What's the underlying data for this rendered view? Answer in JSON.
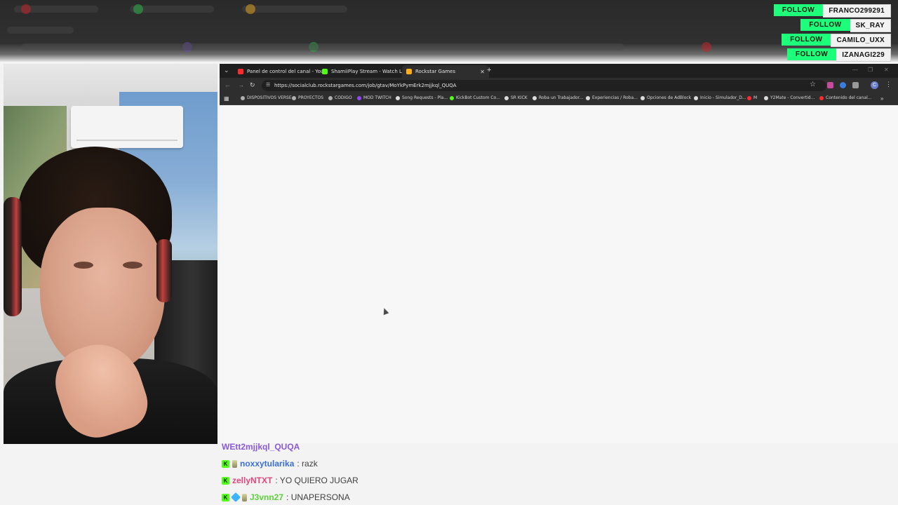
{
  "follows": [
    {
      "button": "FOLLOW",
      "name": "FRANCO299291"
    },
    {
      "button": "FOLLOW",
      "name": "SK_RAY"
    },
    {
      "button": "FOLLOW",
      "name": "CAMILO_UXX"
    },
    {
      "button": "FOLLOW",
      "name": "IZANAGI229"
    }
  ],
  "browser": {
    "tabs": [
      {
        "label": "Panel de control del canal - You",
        "icon": "youtube-icon",
        "color": "#ff2b2b"
      },
      {
        "label": "ShamiiPlay Stream - Watch Liv",
        "icon": "kick-icon",
        "color": "#53fc18"
      },
      {
        "label": "Rockstar Games",
        "icon": "rockstar-icon",
        "color": "#fcaf17"
      }
    ],
    "url": "https://socialclub.rockstargames.com/job/gtav/MoYkPymErk2mjjkql_QUQA",
    "bookmarks": [
      "DISPOSITIVOS VERSE",
      "PROYECTOS",
      "CODIGO",
      "MOD TWITCH",
      "Song Requests - Pla...",
      "KickBot Custom Co...",
      "SR KICK",
      "Roba un Trabajador...",
      "Experiencias / Roba...",
      "Opciones de AdBlock",
      "Inicio - Simulador_D...",
      "M",
      "Y2Mate - Convertid...",
      "Contenido del canal..."
    ]
  },
  "chat": {
    "partial_line": "WEtt2mjjkql_QUQA",
    "lines": [
      {
        "user": "noxxytularika",
        "message": ": razk",
        "user_color": "#3a6fd8"
      },
      {
        "user": "zellyNTXT",
        "message": ": YO QUIERO JUGAR",
        "user_color": "#e0467a"
      },
      {
        "user": "J3vnn27",
        "message": ": UNAPERSONA",
        "user_color": "#5bd13b"
      }
    ]
  },
  "colors": {
    "follow_button": "#1dff7a",
    "kick_badge": "#53fc18"
  }
}
